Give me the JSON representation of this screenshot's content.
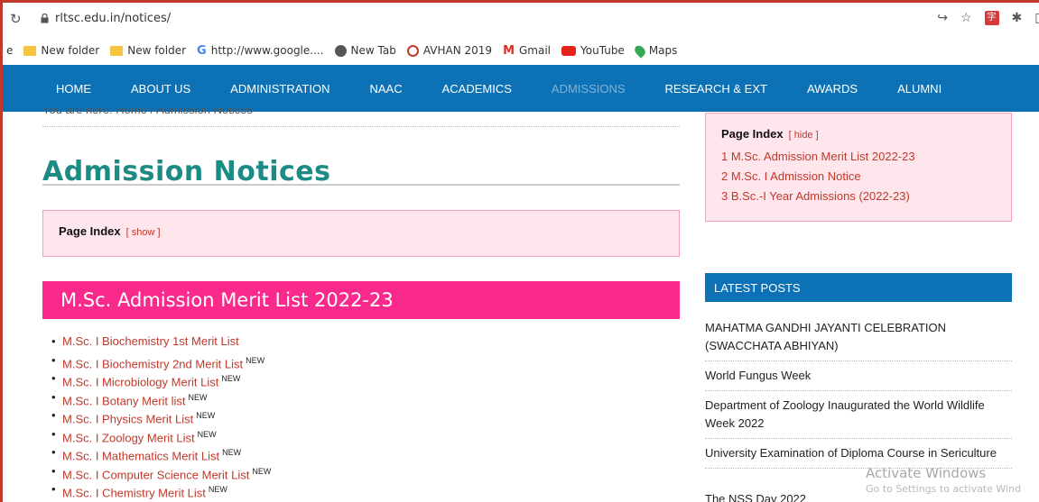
{
  "browser": {
    "url": "rltsc.edu.in/notices/",
    "bookmarks": [
      {
        "label": "New folder",
        "icon": "folder-icon"
      },
      {
        "label": "New folder",
        "icon": "folder-icon"
      },
      {
        "label": "http://www.google....",
        "icon": "google-icon"
      },
      {
        "label": "New Tab",
        "icon": "globe-icon"
      },
      {
        "label": "AVHAN 2019",
        "icon": "avhan-icon"
      },
      {
        "label": "Gmail",
        "icon": "gmail-icon"
      },
      {
        "label": "YouTube",
        "icon": "youtube-icon"
      },
      {
        "label": "Maps",
        "icon": "maps-icon"
      }
    ],
    "bookmark_stub": "e"
  },
  "nav": {
    "items": [
      "HOME",
      "ABOUT US",
      "ADMINISTRATION",
      "NAAC",
      "ACADEMICS",
      "ADMISSIONS",
      "RESEARCH & EXT",
      "AWARDS",
      "ALUMNI"
    ],
    "active": "ADMISSIONS"
  },
  "main": {
    "breadcrumb": "You are here: Home / Admission Notices",
    "title": "Admission Notices",
    "page_index": {
      "label": "Page Index",
      "toggle": "[ show ]"
    },
    "section_title": "M.Sc. Admission Merit List 2022-23",
    "new_badge": "NEW",
    "links": [
      {
        "text": "M.Sc. I Biochemistry 1st Merit List",
        "is_new": false
      },
      {
        "text": "M.Sc. I Biochemistry 2nd Merit List",
        "is_new": true
      },
      {
        "text": "M.Sc. I Microbiology Merit List",
        "is_new": true
      },
      {
        "text": "M.Sc. I Botany Merit list",
        "is_new": true
      },
      {
        "text": "M.Sc. I Physics Merit List",
        "is_new": true
      },
      {
        "text": "M.Sc. I Zoology Merit List",
        "is_new": true
      },
      {
        "text": "M.Sc. I Mathematics Merit List",
        "is_new": true
      },
      {
        "text": "M.Sc. I Computer Science Merit List",
        "is_new": true
      },
      {
        "text": "M.Sc. I Chemistry Merit List",
        "is_new": true
      }
    ]
  },
  "sidebar": {
    "toc": {
      "label": "Page Index",
      "toggle": "[ hide ]",
      "items": [
        "1 M.Sc. Admission Merit List 2022-23",
        "2 M.Sc. I Admission Notice",
        "3 B.Sc.-I Year Admissions (2022-23)"
      ]
    },
    "latest_posts": {
      "heading": "LATEST POSTS",
      "items": [
        "MAHATMA GANDHI JAYANTI CELEBRATION (SWACCHATA ABHIYAN)",
        "World Fungus Week",
        "Department of Zoology Inaugurated the World Wildlife Week 2022",
        "University Examination of Diploma Course in Sericulture",
        "The NSS Day 2022"
      ]
    }
  },
  "watermark": {
    "line1": "Activate Windows",
    "line2": "Go to Settings to activate Wind"
  },
  "colors": {
    "nav_bg": "#0d72b5",
    "title_teal": "#1b8b84",
    "section_pink": "#f92a8c",
    "link_red": "#c0392b",
    "index_box_bg": "#ffe6ec"
  }
}
